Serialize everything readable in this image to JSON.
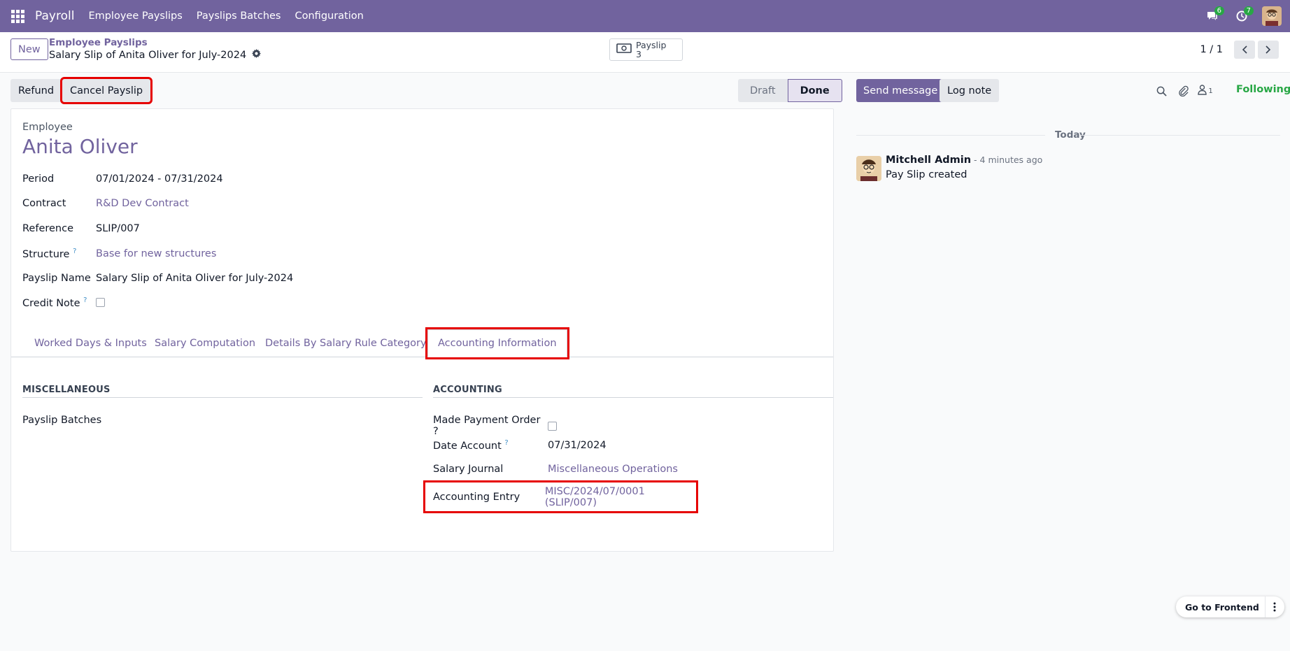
{
  "navbar": {
    "brand": "Payroll",
    "items": [
      "Employee Payslips",
      "Payslips Batches",
      "Configuration"
    ],
    "messages_badge": "6",
    "activities_badge": "7"
  },
  "control": {
    "new_label": "New",
    "breadcrumb_parent": "Employee Payslips",
    "breadcrumb_current": "Salary Slip of Anita Oliver for July-2024",
    "smart_button": {
      "label": "Payslip",
      "count": "3"
    },
    "pager": "1 / 1"
  },
  "actions": {
    "refund": "Refund",
    "cancel": "Cancel Payslip"
  },
  "status": {
    "draft": "Draft",
    "done": "Done"
  },
  "form": {
    "employee_label": "Employee",
    "employee_name": "Anita Oliver",
    "fields": [
      {
        "label": "Period",
        "value": "07/01/2024 - 07/31/2024"
      },
      {
        "label": "Contract",
        "value": "R&D Dev Contract"
      },
      {
        "label": "Reference",
        "value": "SLIP/007"
      },
      {
        "label": "Structure",
        "value": "Base for new structures"
      },
      {
        "label": "Payslip Name",
        "value": "Salary Slip of Anita Oliver for July-2024"
      },
      {
        "label": "Credit Note",
        "value": ""
      }
    ],
    "help_mark": "?",
    "tabs": [
      "Worked Days & Inputs",
      "Salary Computation",
      "Details By Salary Rule Category",
      "Accounting Information"
    ],
    "misc_title": "MISCELLANEOUS",
    "misc_field": "Payslip Batches",
    "accounting_title": "ACCOUNTING",
    "accounting_fields": [
      {
        "label": "Made Payment Order ?",
        "value": ""
      },
      {
        "label": "Date Account",
        "value": "07/31/2024"
      },
      {
        "label": "Salary Journal",
        "value": "Miscellaneous Operations"
      },
      {
        "label": "Accounting Entry",
        "value": "MISC/2024/07/0001 (SLIP/007)"
      }
    ]
  },
  "chatter": {
    "send_message": "Send message",
    "log_note": "Log note",
    "followers_count": "1",
    "following": "Following",
    "today": "Today",
    "author": "Mitchell Admin",
    "time": " - 4 minutes ago",
    "body": "Pay Slip created"
  },
  "go_frontend": "Go to Frontend",
  "colors": {
    "primary": "#71639e",
    "highlight": "#e60000",
    "following": "#28a745"
  }
}
